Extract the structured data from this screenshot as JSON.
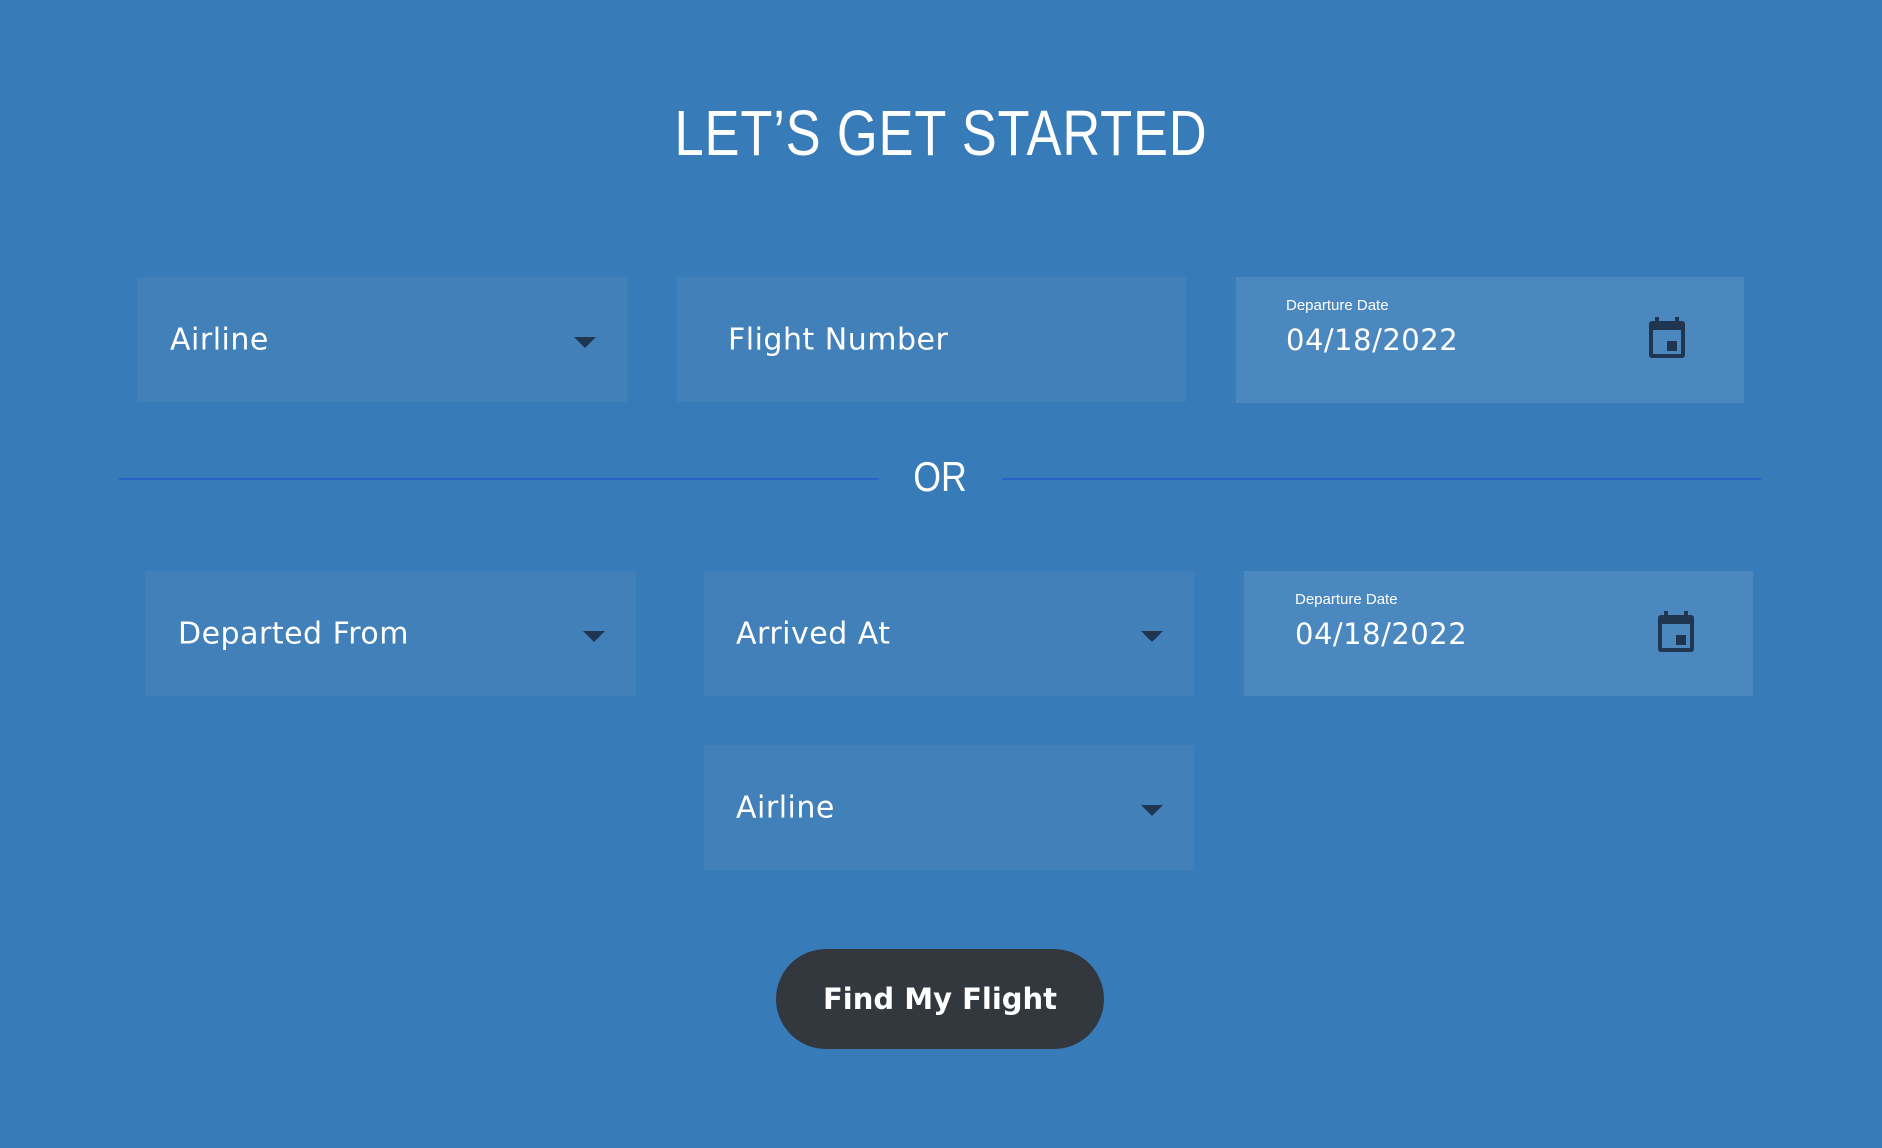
{
  "title": "LET’S GET STARTED",
  "search_by_flight": {
    "airline": {
      "label": "Airline",
      "icon": "chevron-down-icon"
    },
    "flight_number": {
      "placeholder": "Flight Number"
    },
    "departure_date": {
      "label": "Departure Date",
      "value": "04/18/2022",
      "icon": "calendar-icon"
    }
  },
  "separator": {
    "text": "OR"
  },
  "search_by_route": {
    "departed_from": {
      "label": "Departed From",
      "icon": "chevron-down-icon"
    },
    "arrived_at": {
      "label": "Arrived At",
      "icon": "chevron-down-icon"
    },
    "departure_date": {
      "label": "Departure Date",
      "value": "04/18/2022",
      "icon": "calendar-icon"
    },
    "airline": {
      "label": "Airline",
      "icon": "chevron-down-icon"
    }
  },
  "submit": {
    "label": "Find My Flight"
  },
  "colors": {
    "background": "#377bb8",
    "field": "#4280ba",
    "date_field": "#4a88bf",
    "separator_line": "#2a62c7",
    "button": "#33383e",
    "icon": "#1f3550"
  }
}
